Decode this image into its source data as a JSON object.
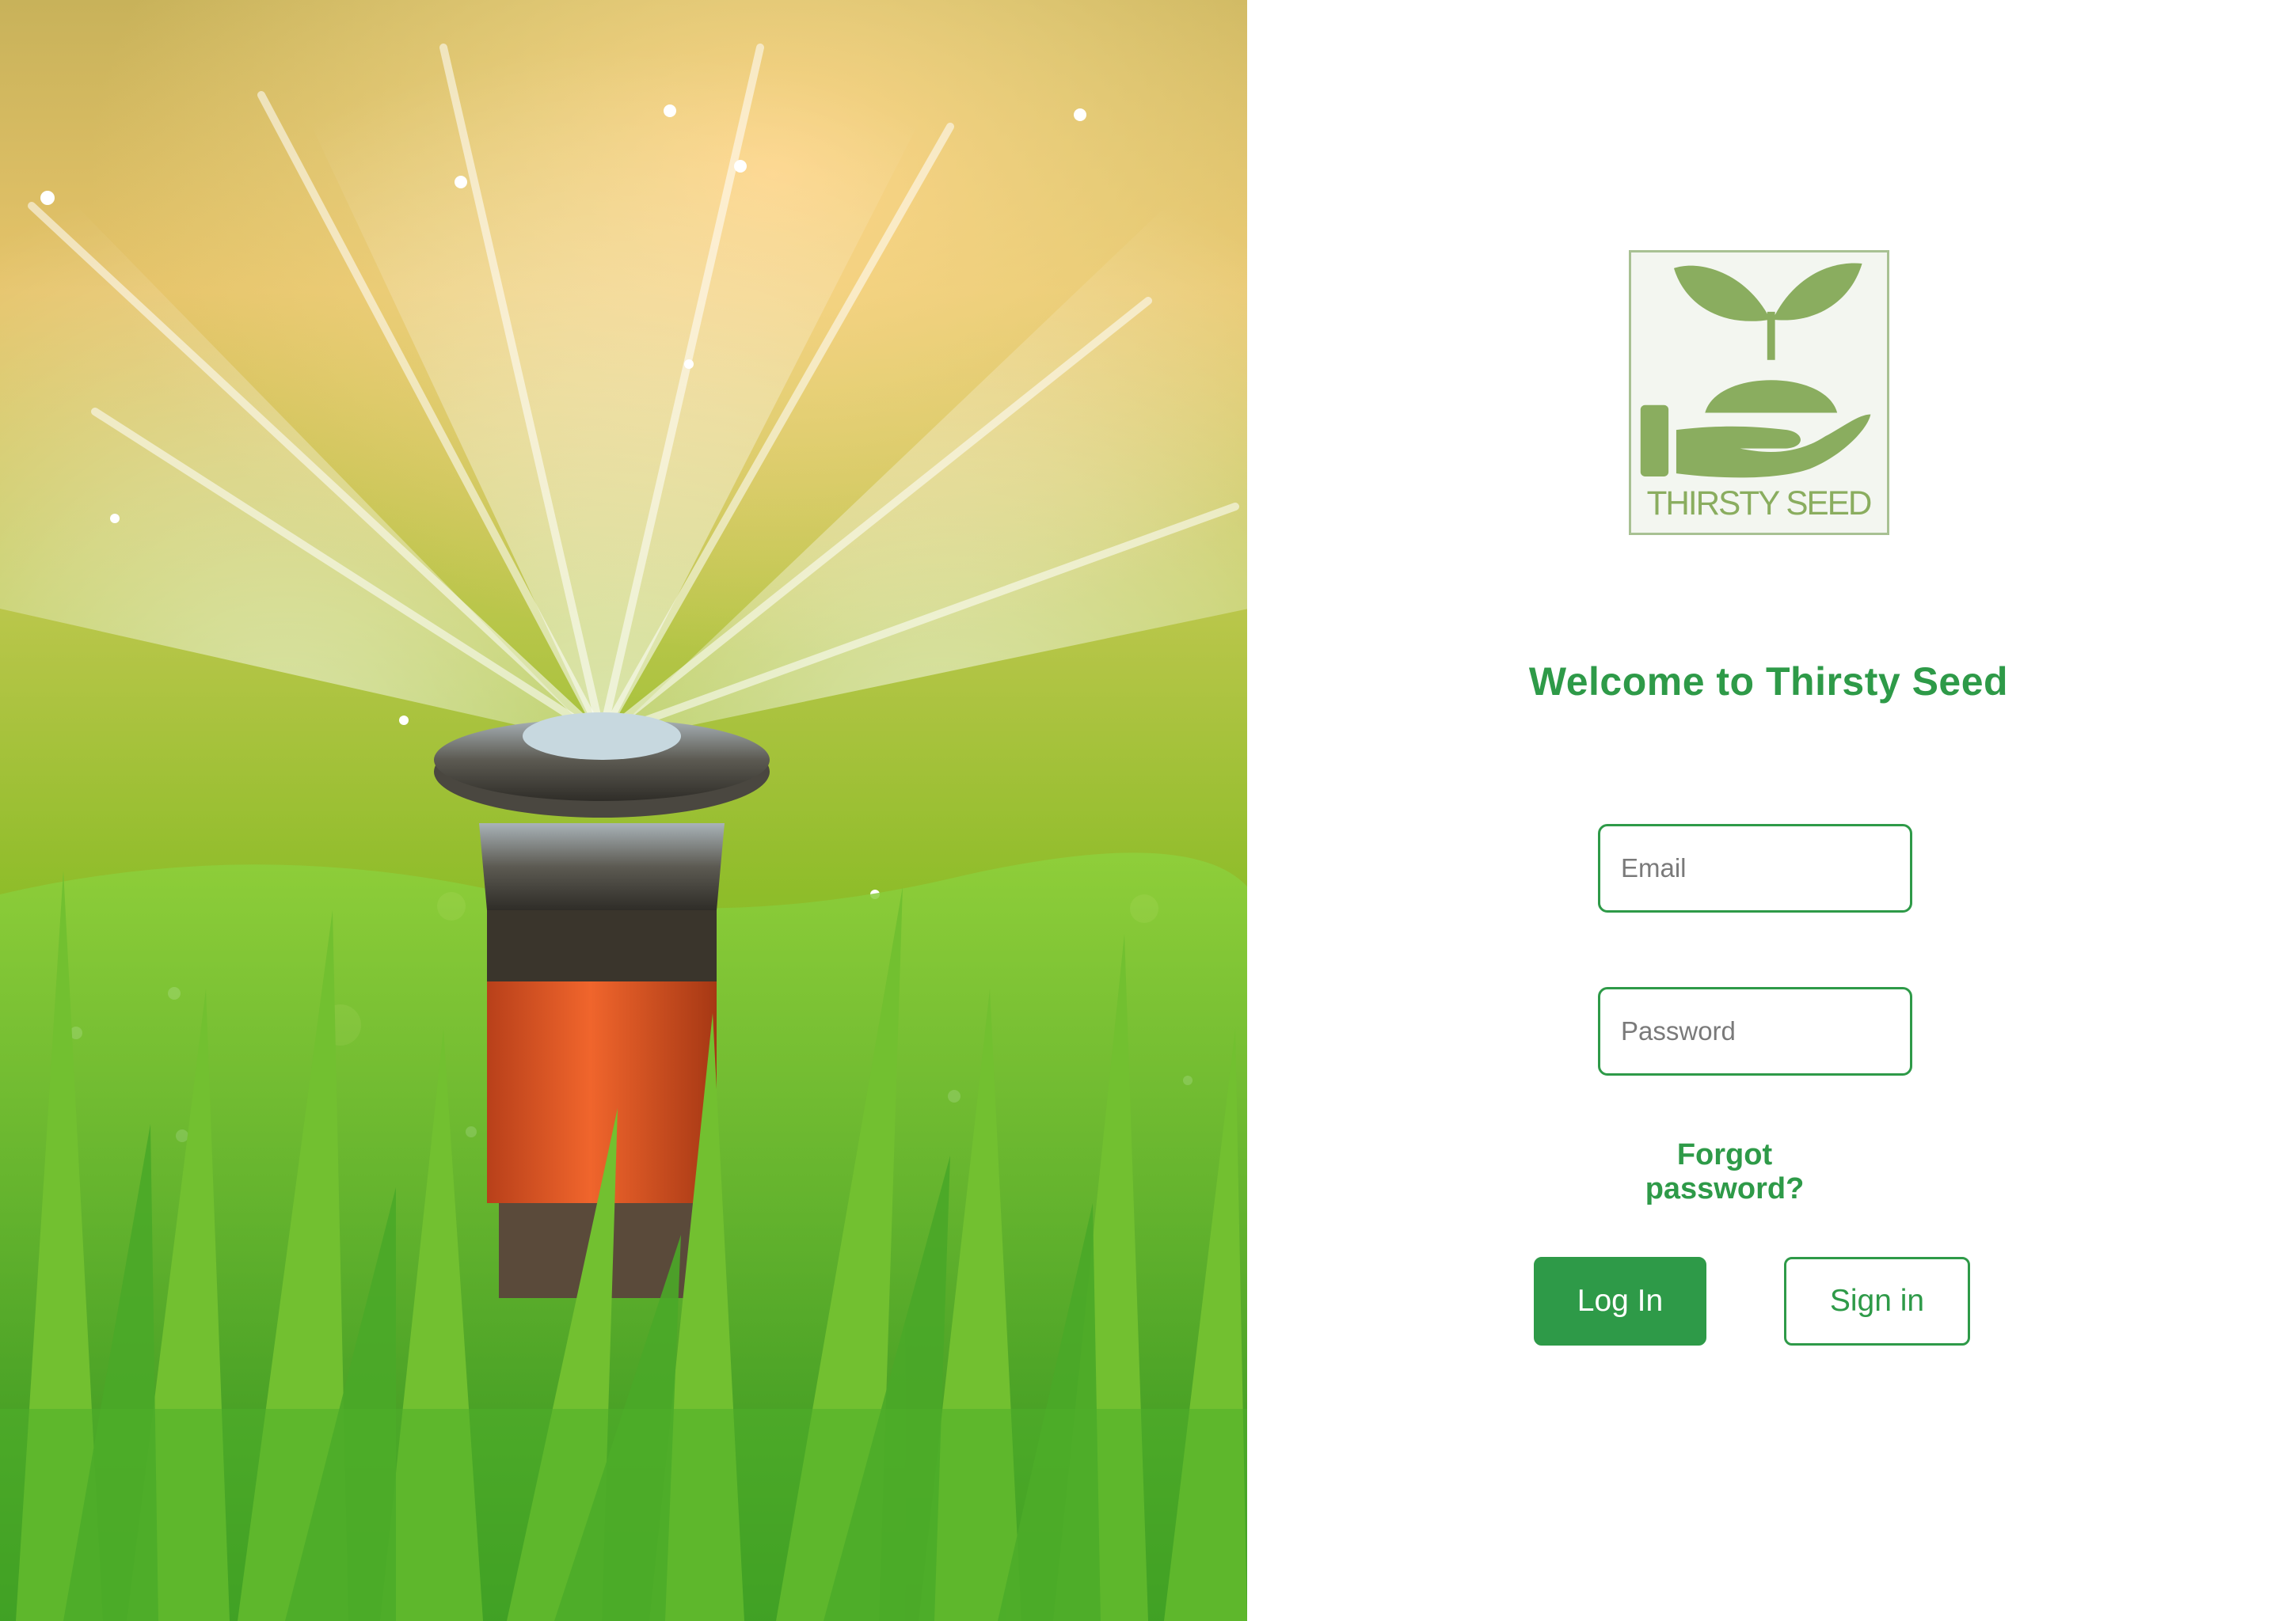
{
  "hero": {
    "alt": "Lawn sprinkler spraying water over grass"
  },
  "brand": {
    "logo_text": "THIRSTY SEED",
    "logo_color": "#8aad5f",
    "accent_color": "#2e9a48"
  },
  "login": {
    "welcome": "Welcome to Thirsty Seed",
    "email_placeholder": "Email",
    "email_value": "",
    "password_placeholder": "Password",
    "password_value": "",
    "forgot_label": "Forgot password?",
    "login_label": "Log In",
    "signin_label": "Sign in"
  }
}
